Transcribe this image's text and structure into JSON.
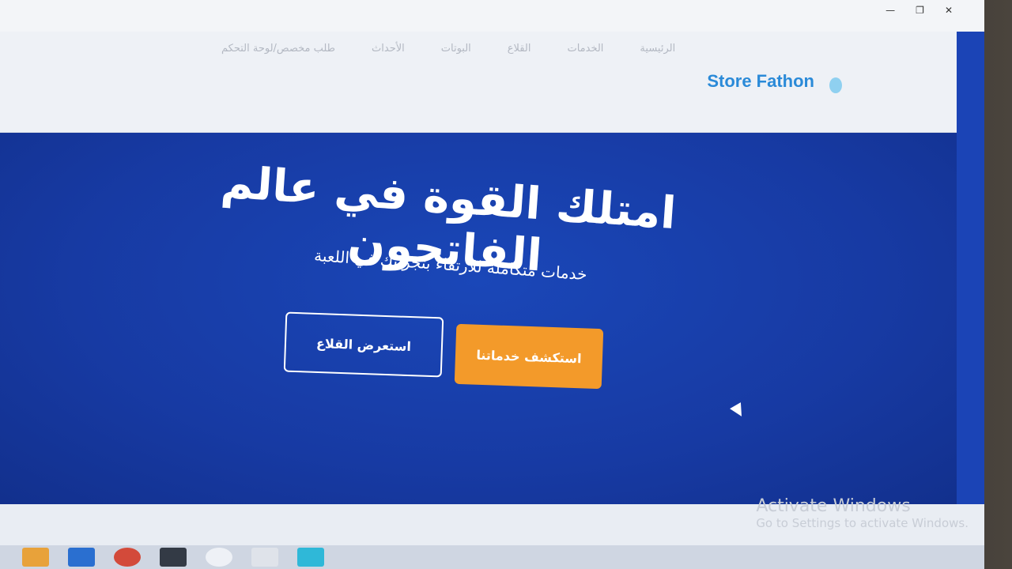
{
  "header": {
    "brand": "Store Fathon",
    "nav": [
      "الرئيسية",
      "الخدمات",
      "القلاع",
      "البوتات",
      "الأحداث",
      "طلب مخصص/لوحة التحكم"
    ]
  },
  "hero": {
    "title": "امتلك القوة في عالم الفاتحون",
    "subtitle": "خدمات متكاملة للارتقاء بتجربتك في اللعبة",
    "primary_button": "استكشف خدماتنا",
    "secondary_button": "استعرض القلاع"
  },
  "windows_notice": {
    "line1": "Activate Windows",
    "line2": "Go to Settings to activate Windows."
  },
  "colors": {
    "hero_bg": "#1b44b6",
    "brand": "#2a8ad8",
    "primary_button": "#f39a2a"
  }
}
